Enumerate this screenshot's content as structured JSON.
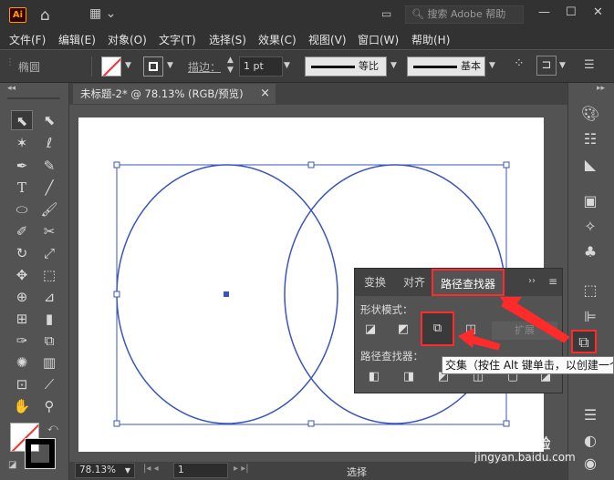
{
  "app": {
    "logo": "Ai"
  },
  "search": {
    "label": "搜索 Adobe 帮助"
  },
  "menu": [
    "文件(F)",
    "编辑(E)",
    "对象(O)",
    "文字(T)",
    "选择(S)",
    "效果(C)",
    "视图(V)",
    "窗口(W)",
    "帮助(H)"
  ],
  "control": {
    "object_type": "椭圆",
    "stroke_label": "描边：",
    "stroke_value": "1 pt",
    "profile_label": "等比",
    "brush_label": "基本"
  },
  "document": {
    "tab_title": "未标题-2* @ 78.13% (RGB/预览)",
    "close": "×"
  },
  "status": {
    "zoom": "78.13%",
    "artboard": "1",
    "tool": "选择"
  },
  "pathfinder": {
    "tabs": [
      "变换",
      "对齐",
      "路径查找器"
    ],
    "shape_modes_label": "形状模式：",
    "expand_label": "扩展",
    "pathfinders_label": "路径查找器："
  },
  "tooltip": {
    "text": "交集（按住 Alt 键单击，以创建一个"
  },
  "watermark": {
    "brand": "Baidu 经验",
    "url": "jingyan.baidu.com"
  },
  "colors": {
    "accent_red": "#ff2a2a",
    "path_blue": "#3a55c0",
    "canvas": "#ffffff"
  }
}
